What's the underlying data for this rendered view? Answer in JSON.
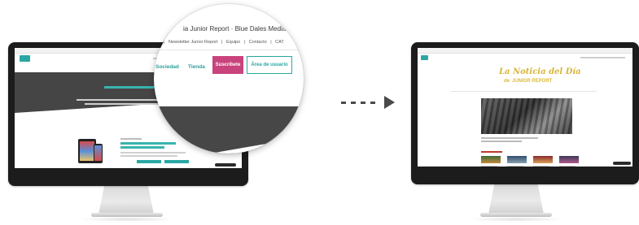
{
  "magnifier": {
    "window_title": "ia Junior Report · Blue Dales Media",
    "top_nav": [
      "|",
      "Newsletter Junior Report",
      "|",
      "Equipo",
      "|",
      "Contacto",
      "|",
      "CAT"
    ],
    "nav_items": [
      "Sociedad",
      "Tienda"
    ],
    "subscribe_label": "Suscríbete",
    "user_area_label": "Área de usuario"
  },
  "right_site": {
    "title": "La Noticia del Día",
    "subtitle_prefix": "de",
    "subtitle": "JUNIOR REPORT"
  },
  "colors": {
    "teal": "#2aa7a4",
    "magenta": "#c9437c",
    "dark": "#454545",
    "gold": "#d9b53a"
  },
  "icons": [
    "arrow-right-icon"
  ]
}
